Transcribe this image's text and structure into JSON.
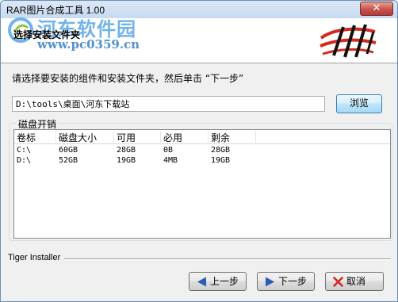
{
  "window": {
    "title": "RAR图片合成工具 1.00",
    "close_label": "✕"
  },
  "watermark": {
    "line1": "河东软件园",
    "line2": "www.pc0359.cn"
  },
  "header": {
    "title": "选择安装文件夹"
  },
  "instruction": "请选择要安装的组件和安装文件夹，然后单击 “下一步”",
  "path": {
    "value": "D:\\tools\\桌面\\河东下载站",
    "browse_label": "浏览"
  },
  "disk_group": {
    "label": "磁盘开销",
    "columns": [
      "卷标",
      "磁盘大小",
      "可用",
      "必用",
      "剩余"
    ],
    "rows": [
      {
        "volume": "C:\\",
        "size": "60GB",
        "available": "28GB",
        "required": "0B",
        "remaining": "28GB"
      },
      {
        "volume": "D:\\",
        "size": "52GB",
        "available": "19GB",
        "required": "4MB",
        "remaining": "19GB"
      }
    ]
  },
  "footer": {
    "brand": "Tiger Installer",
    "prev_label": "上一步",
    "next_label": "下一步",
    "cancel_label": "取消"
  },
  "colors": {
    "accent_red": "#d4291c",
    "nav_icon_blue": "#2a5cb8",
    "watermark_blue": "#5aa6e8"
  }
}
